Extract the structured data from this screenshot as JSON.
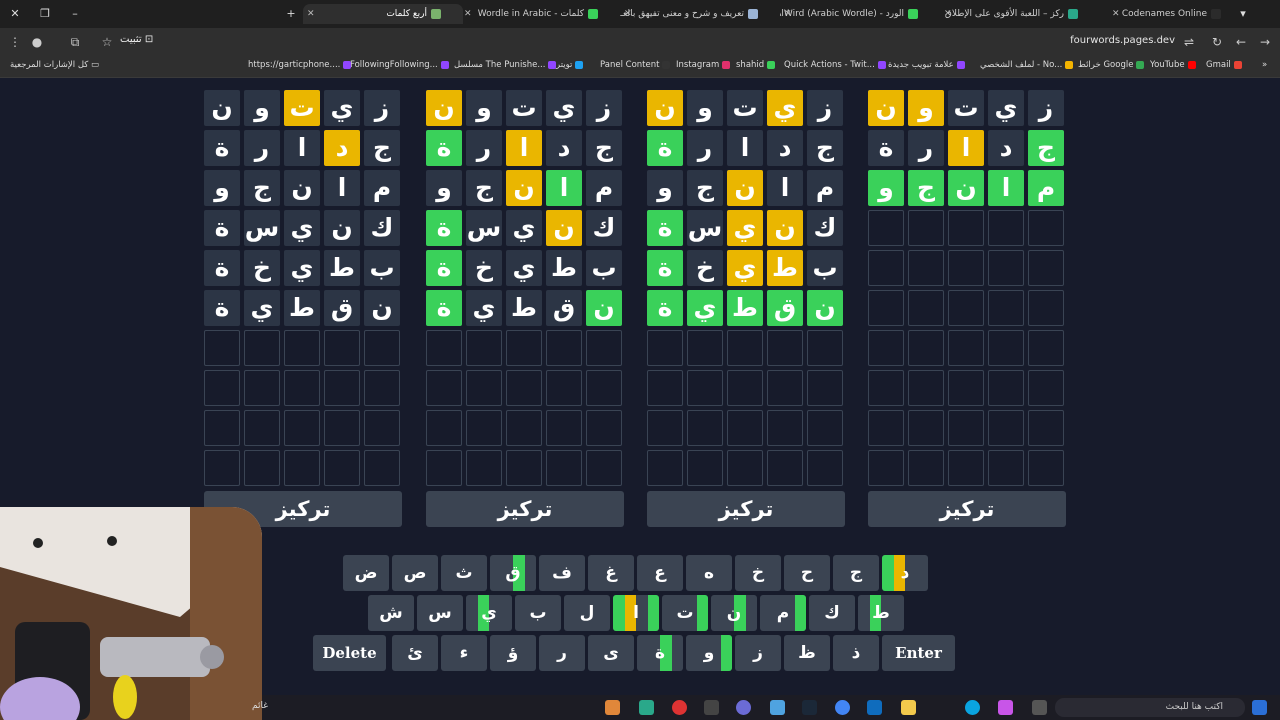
{
  "tabs": [
    {
      "title": "Codenames Online",
      "active": false,
      "color": "#2b2b2b"
    },
    {
      "title": "ركز – اللعبة الأقوى على الإطلاق",
      "active": false,
      "color": "#2aa88a"
    },
    {
      "title": "الورد - AlWird (Arabic Wordle)",
      "active": false,
      "color": "#3ad15a"
    },
    {
      "title": "تعريف و شرح و معنى تفيهق بالعـ",
      "active": false,
      "color": "#9bb4d6"
    },
    {
      "title": "كلمات - Wordle in Arabic",
      "active": false,
      "color": "#3ad15a"
    },
    {
      "title": "أربع كلمات",
      "active": true,
      "color": "#7ab36c"
    }
  ],
  "address": {
    "url": "fourwords.pages.dev",
    "install_label": "تثبيت"
  },
  "bookmarks": [
    {
      "label": "Gmail",
      "color": "#ea4335"
    },
    {
      "label": "YouTube",
      "color": "#ff0000"
    },
    {
      "label": "خرائط Google",
      "color": "#34a853"
    },
    {
      "label": "لملف الشخصي - No...",
      "color": "#f4b400"
    },
    {
      "label": "علامة تبويب جديدة",
      "color": "#9146ff"
    },
    {
      "label": "Quick Actions - Twit...",
      "color": "#9146ff"
    },
    {
      "label": "shahid",
      "color": "#3ad15a"
    },
    {
      "label": "Instagram",
      "color": "#e1306c"
    },
    {
      "label": "Panel Content",
      "color": "#333333"
    },
    {
      "label": "تويتر",
      "color": "#1da1f2"
    },
    {
      "label": "مسلسل The Punishe...",
      "color": "#9146ff"
    },
    {
      "label": "FollowingFollowing...",
      "color": "#9146ff"
    },
    {
      "label": "https://garticphone....",
      "color": "#9146ff"
    }
  ],
  "all_bookmarks_label": "كل الإشارات المرجعية",
  "boards": [
    {
      "rows": [
        [
          {
            "l": "ز",
            "s": "n"
          },
          {
            "l": "ي",
            "s": "n"
          },
          {
            "l": "ت",
            "s": "n"
          },
          {
            "l": "و",
            "s": "p"
          },
          {
            "l": "ن",
            "s": "p"
          }
        ],
        [
          {
            "l": "ج",
            "s": "c"
          },
          {
            "l": "د",
            "s": "n"
          },
          {
            "l": "ا",
            "s": "p"
          },
          {
            "l": "ر",
            "s": "n"
          },
          {
            "l": "ة",
            "s": "n"
          }
        ],
        [
          {
            "l": "م",
            "s": "c"
          },
          {
            "l": "ا",
            "s": "c"
          },
          {
            "l": "ن",
            "s": "c"
          },
          {
            "l": "ج",
            "s": "c"
          },
          {
            "l": "و",
            "s": "c"
          }
        ]
      ]
    },
    {
      "rows": [
        [
          {
            "l": "ز",
            "s": "n"
          },
          {
            "l": "ي",
            "s": "p"
          },
          {
            "l": "ت",
            "s": "n"
          },
          {
            "l": "و",
            "s": "n"
          },
          {
            "l": "ن",
            "s": "p"
          }
        ],
        [
          {
            "l": "ج",
            "s": "n"
          },
          {
            "l": "د",
            "s": "n"
          },
          {
            "l": "ا",
            "s": "n"
          },
          {
            "l": "ر",
            "s": "n"
          },
          {
            "l": "ة",
            "s": "c"
          }
        ],
        [
          {
            "l": "م",
            "s": "n"
          },
          {
            "l": "ا",
            "s": "n"
          },
          {
            "l": "ن",
            "s": "p"
          },
          {
            "l": "ج",
            "s": "n"
          },
          {
            "l": "و",
            "s": "n"
          }
        ],
        [
          {
            "l": "ك",
            "s": "n"
          },
          {
            "l": "ن",
            "s": "p"
          },
          {
            "l": "ي",
            "s": "p"
          },
          {
            "l": "س",
            "s": "n"
          },
          {
            "l": "ة",
            "s": "c"
          }
        ],
        [
          {
            "l": "ب",
            "s": "n"
          },
          {
            "l": "ط",
            "s": "p"
          },
          {
            "l": "ي",
            "s": "p"
          },
          {
            "l": "خ",
            "s": "n"
          },
          {
            "l": "ة",
            "s": "c"
          }
        ],
        [
          {
            "l": "ن",
            "s": "c"
          },
          {
            "l": "ق",
            "s": "c"
          },
          {
            "l": "ط",
            "s": "c"
          },
          {
            "l": "ي",
            "s": "c"
          },
          {
            "l": "ة",
            "s": "c"
          }
        ]
      ]
    },
    {
      "rows": [
        [
          {
            "l": "ز",
            "s": "n"
          },
          {
            "l": "ي",
            "s": "n"
          },
          {
            "l": "ت",
            "s": "n"
          },
          {
            "l": "و",
            "s": "n"
          },
          {
            "l": "ن",
            "s": "p"
          }
        ],
        [
          {
            "l": "ج",
            "s": "n"
          },
          {
            "l": "د",
            "s": "n"
          },
          {
            "l": "ا",
            "s": "p"
          },
          {
            "l": "ر",
            "s": "n"
          },
          {
            "l": "ة",
            "s": "c"
          }
        ],
        [
          {
            "l": "م",
            "s": "n"
          },
          {
            "l": "ا",
            "s": "c"
          },
          {
            "l": "ن",
            "s": "p"
          },
          {
            "l": "ج",
            "s": "n"
          },
          {
            "l": "و",
            "s": "n"
          }
        ],
        [
          {
            "l": "ك",
            "s": "n"
          },
          {
            "l": "ن",
            "s": "p"
          },
          {
            "l": "ي",
            "s": "n"
          },
          {
            "l": "س",
            "s": "n"
          },
          {
            "l": "ة",
            "s": "c"
          }
        ],
        [
          {
            "l": "ب",
            "s": "n"
          },
          {
            "l": "ط",
            "s": "n"
          },
          {
            "l": "ي",
            "s": "n"
          },
          {
            "l": "خ",
            "s": "n"
          },
          {
            "l": "ة",
            "s": "c"
          }
        ],
        [
          {
            "l": "ن",
            "s": "c"
          },
          {
            "l": "ق",
            "s": "n"
          },
          {
            "l": "ط",
            "s": "n"
          },
          {
            "l": "ي",
            "s": "n"
          },
          {
            "l": "ة",
            "s": "c"
          }
        ]
      ]
    },
    {
      "rows": [
        [
          {
            "l": "ز",
            "s": "n"
          },
          {
            "l": "ي",
            "s": "n"
          },
          {
            "l": "ت",
            "s": "p"
          },
          {
            "l": "و",
            "s": "n"
          },
          {
            "l": "ن",
            "s": "n"
          }
        ],
        [
          {
            "l": "ج",
            "s": "n"
          },
          {
            "l": "د",
            "s": "p"
          },
          {
            "l": "ا",
            "s": "n"
          },
          {
            "l": "ر",
            "s": "n"
          },
          {
            "l": "ة",
            "s": "n"
          }
        ],
        [
          {
            "l": "م",
            "s": "n"
          },
          {
            "l": "ا",
            "s": "n"
          },
          {
            "l": "ن",
            "s": "n"
          },
          {
            "l": "ج",
            "s": "n"
          },
          {
            "l": "و",
            "s": "n"
          }
        ],
        [
          {
            "l": "ك",
            "s": "n"
          },
          {
            "l": "ن",
            "s": "n"
          },
          {
            "l": "ي",
            "s": "n"
          },
          {
            "l": "س",
            "s": "n"
          },
          {
            "l": "ة",
            "s": "n"
          }
        ],
        [
          {
            "l": "ب",
            "s": "n"
          },
          {
            "l": "ط",
            "s": "n"
          },
          {
            "l": "ي",
            "s": "n"
          },
          {
            "l": "خ",
            "s": "n"
          },
          {
            "l": "ة",
            "s": "n"
          }
        ],
        [
          {
            "l": "ن",
            "s": "n"
          },
          {
            "l": "ق",
            "s": "n"
          },
          {
            "l": "ط",
            "s": "n"
          },
          {
            "l": "ي",
            "s": "n"
          },
          {
            "l": "ة",
            "s": "n"
          }
        ]
      ]
    }
  ],
  "focus_label": "تركيز",
  "keyboard": {
    "row1": [
      "د",
      "ج",
      "ح",
      "خ",
      "ه",
      "ع",
      "غ",
      "ف",
      "ق",
      "ث",
      "ص",
      "ض"
    ],
    "row2": [
      "ط",
      "ك",
      "م",
      "ن",
      "ت",
      "ا",
      "ل",
      "ب",
      "ي",
      "س",
      "ش"
    ],
    "row3_letters": [
      "ذ",
      "ظ",
      "ز",
      "و",
      "ة",
      "ى",
      "ر",
      "ؤ",
      "ء",
      "ئ"
    ],
    "enter_label": "Enter",
    "delete_label": "Delete"
  },
  "colors": {
    "correct": "#3ad15a",
    "present": "#eab600",
    "key": "#3b4452",
    "background": "#171b2b"
  },
  "taskbar": {
    "search_placeholder": "اكتب هنا للبحث",
    "weather_text": "غائم"
  }
}
